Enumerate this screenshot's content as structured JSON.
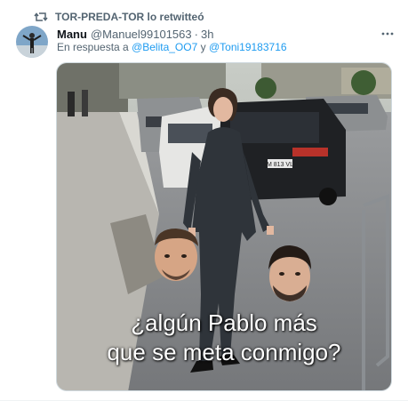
{
  "retweet": {
    "icon": "retweet-icon",
    "text": "TOR-PREDA-TOR lo retwitteó"
  },
  "author": {
    "name": "Manu",
    "handle": "@Manuel99101563",
    "separator": "·",
    "time": "3h"
  },
  "reply": {
    "prefix": "En respuesta a",
    "mention1": "@Belita_OO7",
    "conjunction": "y",
    "mention2": "@Toni19183716"
  },
  "more_icon": "more-horizontal-icon",
  "media": {
    "caption_line1": "¿algún Pablo más",
    "caption_line2": "que se meta conmigo?",
    "license_plate": "M 813 VL"
  },
  "colors": {
    "link": "#1d9bf0",
    "secondary_text": "#536471",
    "primary_text": "#0f1419"
  }
}
